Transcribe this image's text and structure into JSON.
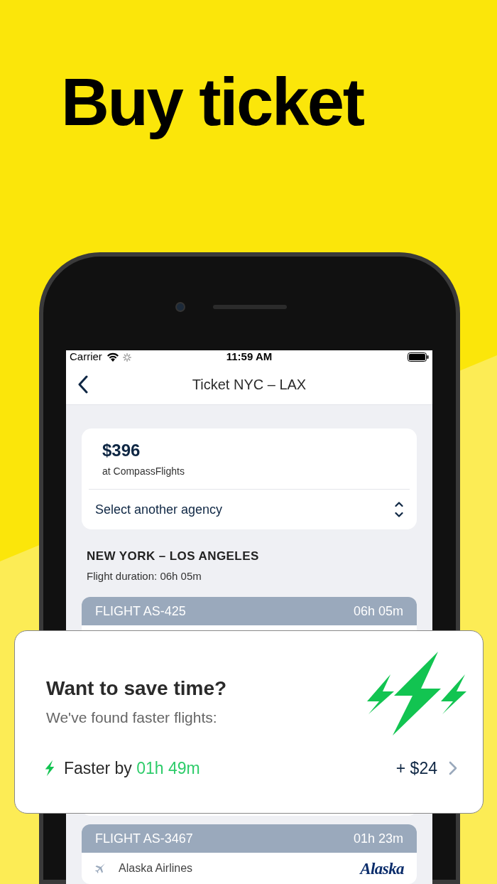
{
  "headline": "Buy ticket",
  "status_bar": {
    "carrier": "Carrier",
    "time": "11:59 AM"
  },
  "nav": {
    "title": "Ticket NYC – LAX"
  },
  "offer": {
    "price": "$396",
    "agency": "at CompassFlights",
    "select_label": "Select another agency"
  },
  "route": {
    "title": "NEW YORK – LOS ANGELES",
    "duration": "Flight duration: 06h 05m"
  },
  "flights": [
    {
      "number": "FLIGHT AS-425",
      "duration": "06h 05m"
    },
    {
      "number": "FLIGHT AS-3467",
      "duration": "01h 23m",
      "airline": "Alaska Airlines",
      "logo": "Alaska"
    }
  ],
  "popup": {
    "title": "Want to save time?",
    "subtitle": "We've found faster flights:",
    "faster_label": "Faster by",
    "faster_time": "01h 49m",
    "price_delta": "+ $24"
  }
}
